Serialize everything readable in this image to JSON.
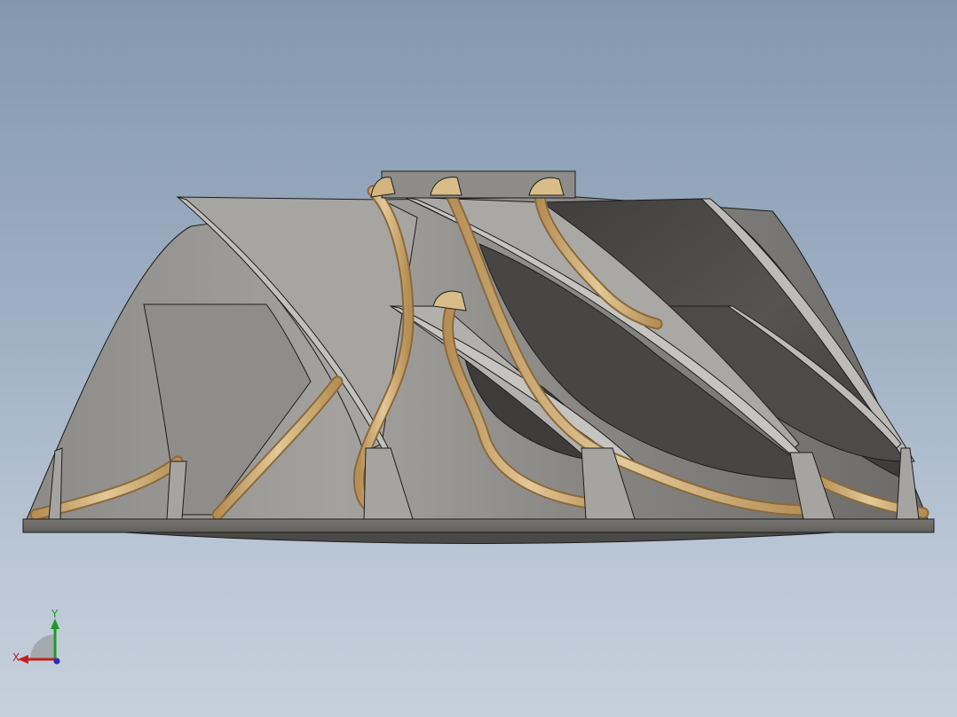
{
  "viewport": {
    "background_top": "#8497ad",
    "background_bottom": "#c6d0dc"
  },
  "model": {
    "description_icon": "impeller-3d-model",
    "colors": {
      "body_light": "#9c9a97",
      "body_mid": "#7e7c79",
      "body_dark": "#4b4a48",
      "fillet_gold": "#c8a268",
      "fillet_gold_light": "#e2c595",
      "edge": "#1d1d1d"
    }
  },
  "triad": {
    "x_label": "X",
    "y_label": "Y",
    "x_color": "#c42020",
    "y_color": "#1e9a25",
    "z_color": "#2030c0"
  }
}
